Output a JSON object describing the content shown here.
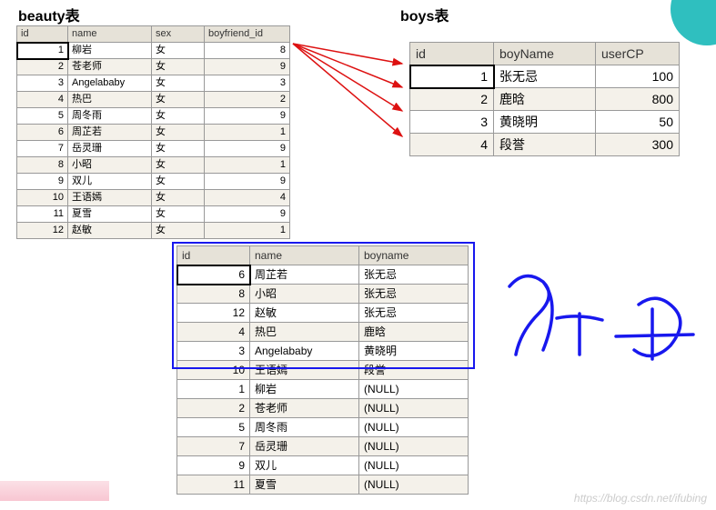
{
  "titles": {
    "beauty": "beauty表",
    "boys": "boys表"
  },
  "beauty": {
    "headers": {
      "id": "id",
      "name": "name",
      "sex": "sex",
      "bf": "boyfriend_id"
    },
    "rows": [
      {
        "id": "1",
        "name": "柳岩",
        "sex": "女",
        "bf": "8"
      },
      {
        "id": "2",
        "name": "苍老师",
        "sex": "女",
        "bf": "9"
      },
      {
        "id": "3",
        "name": "Angelababy",
        "sex": "女",
        "bf": "3"
      },
      {
        "id": "4",
        "name": "热巴",
        "sex": "女",
        "bf": "2"
      },
      {
        "id": "5",
        "name": "周冬雨",
        "sex": "女",
        "bf": "9"
      },
      {
        "id": "6",
        "name": "周芷若",
        "sex": "女",
        "bf": "1"
      },
      {
        "id": "7",
        "name": "岳灵珊",
        "sex": "女",
        "bf": "9"
      },
      {
        "id": "8",
        "name": "小昭",
        "sex": "女",
        "bf": "1"
      },
      {
        "id": "9",
        "name": "双儿",
        "sex": "女",
        "bf": "9"
      },
      {
        "id": "10",
        "name": "王语嫣",
        "sex": "女",
        "bf": "4"
      },
      {
        "id": "11",
        "name": "夏雪",
        "sex": "女",
        "bf": "9"
      },
      {
        "id": "12",
        "name": "赵敏",
        "sex": "女",
        "bf": "1"
      }
    ]
  },
  "boys": {
    "headers": {
      "id": "id",
      "boyName": "boyName",
      "userCP": "userCP"
    },
    "rows": [
      {
        "id": "1",
        "boyName": "张无忌",
        "userCP": "100"
      },
      {
        "id": "2",
        "boyName": "鹿晗",
        "userCP": "800"
      },
      {
        "id": "3",
        "boyName": "黄晓明",
        "userCP": "50"
      },
      {
        "id": "4",
        "boyName": "段誉",
        "userCP": "300"
      }
    ]
  },
  "result": {
    "headers": {
      "id": "id",
      "name": "name",
      "boyname": "boyname"
    },
    "rows": [
      {
        "id": "6",
        "name": "周芷若",
        "boyname": "张无忌"
      },
      {
        "id": "8",
        "name": "小昭",
        "boyname": "张无忌"
      },
      {
        "id": "12",
        "name": "赵敏",
        "boyname": "张无忌"
      },
      {
        "id": "4",
        "name": "热巴",
        "boyname": "鹿晗"
      },
      {
        "id": "3",
        "name": "Angelababy",
        "boyname": "黄晓明"
      },
      {
        "id": "10",
        "name": "王语嫣",
        "boyname": "段誉"
      },
      {
        "id": "1",
        "name": "柳岩",
        "boyname": "(NULL)"
      },
      {
        "id": "2",
        "name": "苍老师",
        "boyname": "(NULL)"
      },
      {
        "id": "5",
        "name": "周冬雨",
        "boyname": "(NULL)"
      },
      {
        "id": "7",
        "name": "岳灵珊",
        "boyname": "(NULL)"
      },
      {
        "id": "9",
        "name": "双儿",
        "boyname": "(NULL)"
      },
      {
        "id": "11",
        "name": "夏雪",
        "boyname": "(NULL)"
      }
    ]
  },
  "watermark": "https://blog.csdn.net/ifubing",
  "annotation": "内连"
}
